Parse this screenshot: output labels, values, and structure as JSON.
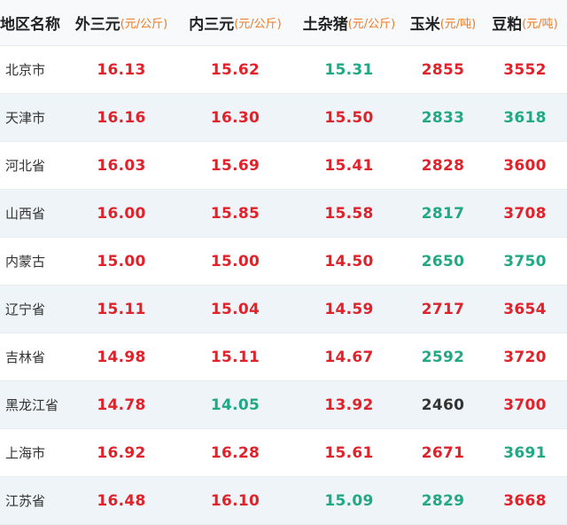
{
  "header": {
    "region": "地区名称",
    "outer": {
      "label": "外三元",
      "unit": "(元/公斤)"
    },
    "inner": {
      "label": "内三元",
      "unit": "(元/公斤)"
    },
    "local": {
      "label": "土杂猪",
      "unit": "(元/公斤)"
    },
    "corn": {
      "label": "玉米",
      "unit": "(元/吨)"
    },
    "soy": {
      "label": "豆粕",
      "unit": "(元/吨)"
    }
  },
  "colors": {
    "up": "#e0222b",
    "down": "#21a884",
    "flat": "#333333",
    "unit": "#f07a22"
  },
  "rows": [
    {
      "region": "北京市",
      "outer": "16.13",
      "outer_t": "up",
      "inner": "15.62",
      "inner_t": "up",
      "local": "15.31",
      "local_t": "down",
      "corn": "2855",
      "corn_t": "up",
      "soy": "3552",
      "soy_t": "up"
    },
    {
      "region": "天津市",
      "outer": "16.16",
      "outer_t": "up",
      "inner": "16.30",
      "inner_t": "up",
      "local": "15.50",
      "local_t": "up",
      "corn": "2833",
      "corn_t": "down",
      "soy": "3618",
      "soy_t": "down"
    },
    {
      "region": "河北省",
      "outer": "16.03",
      "outer_t": "up",
      "inner": "15.69",
      "inner_t": "up",
      "local": "15.41",
      "local_t": "up",
      "corn": "2828",
      "corn_t": "up",
      "soy": "3600",
      "soy_t": "up"
    },
    {
      "region": "山西省",
      "outer": "16.00",
      "outer_t": "up",
      "inner": "15.85",
      "inner_t": "up",
      "local": "15.58",
      "local_t": "up",
      "corn": "2817",
      "corn_t": "down",
      "soy": "3708",
      "soy_t": "up"
    },
    {
      "region": "内蒙古",
      "outer": "15.00",
      "outer_t": "up",
      "inner": "15.00",
      "inner_t": "up",
      "local": "14.50",
      "local_t": "up",
      "corn": "2650",
      "corn_t": "down",
      "soy": "3750",
      "soy_t": "down"
    },
    {
      "region": "辽宁省",
      "outer": "15.11",
      "outer_t": "up",
      "inner": "15.04",
      "inner_t": "up",
      "local": "14.59",
      "local_t": "up",
      "corn": "2717",
      "corn_t": "up",
      "soy": "3654",
      "soy_t": "up"
    },
    {
      "region": "吉林省",
      "outer": "14.98",
      "outer_t": "up",
      "inner": "15.11",
      "inner_t": "up",
      "local": "14.67",
      "local_t": "up",
      "corn": "2592",
      "corn_t": "down",
      "soy": "3720",
      "soy_t": "up"
    },
    {
      "region": "黑龙江省",
      "outer": "14.78",
      "outer_t": "up",
      "inner": "14.05",
      "inner_t": "down",
      "local": "13.92",
      "local_t": "up",
      "corn": "2460",
      "corn_t": "flat",
      "soy": "3700",
      "soy_t": "up"
    },
    {
      "region": "上海市",
      "outer": "16.92",
      "outer_t": "up",
      "inner": "16.28",
      "inner_t": "up",
      "local": "15.61",
      "local_t": "up",
      "corn": "2671",
      "corn_t": "up",
      "soy": "3691",
      "soy_t": "down"
    },
    {
      "region": "江苏省",
      "outer": "16.48",
      "outer_t": "up",
      "inner": "16.10",
      "inner_t": "up",
      "local": "15.09",
      "local_t": "down",
      "corn": "2829",
      "corn_t": "down",
      "soy": "3668",
      "soy_t": "up"
    }
  ]
}
